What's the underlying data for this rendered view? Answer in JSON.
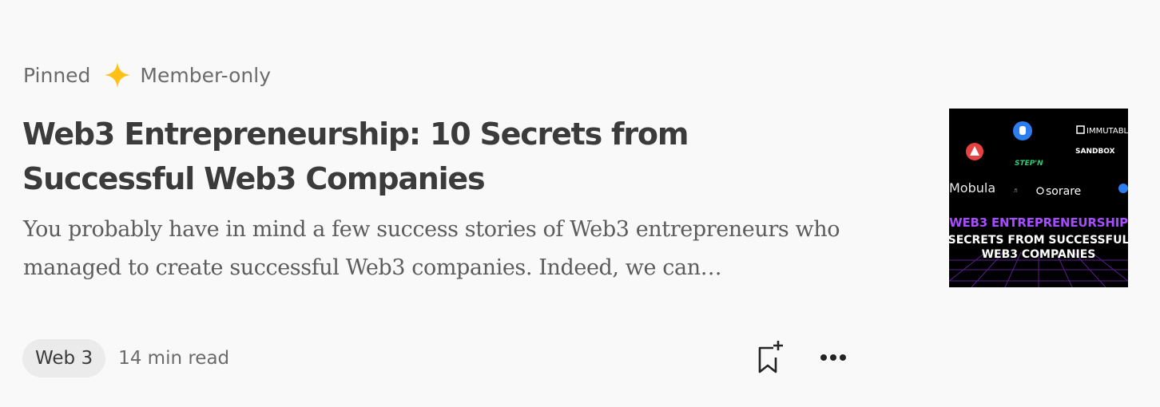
{
  "post": {
    "pinned_label": "Pinned",
    "member_label": "Member-only",
    "star_icon": "member-star-icon",
    "star_color": "#ffc017",
    "title": "Web3 Entrepreneurship: 10 Secrets from Successful Web3 Companies",
    "excerpt": "You probably have in mind a few success stories of Web3 entrepreneurs who managed to create successful Web3 companies. Indeed, we can…",
    "tag": "Web 3",
    "read_time": "14 min read",
    "save_icon": "bookmark-add-icon",
    "more_icon": "more-options-icon"
  },
  "thumbnail": {
    "logos": {
      "immutable": "IMMUTABL",
      "sandbox": "SANDBOX",
      "stepn": "STEP'N",
      "mobula": "Mobula",
      "mobula_suffix": ".fi",
      "sorare": "sorare"
    },
    "headline_line1": "WEB3 ENTREPRENEURSHIP",
    "headline_line2": "SECRETS FROM SUCCESSFUL",
    "headline_line3": "WEB3 COMPANIES",
    "accent_purple": "#a64dff",
    "grid_color": "#5a1f8f"
  }
}
